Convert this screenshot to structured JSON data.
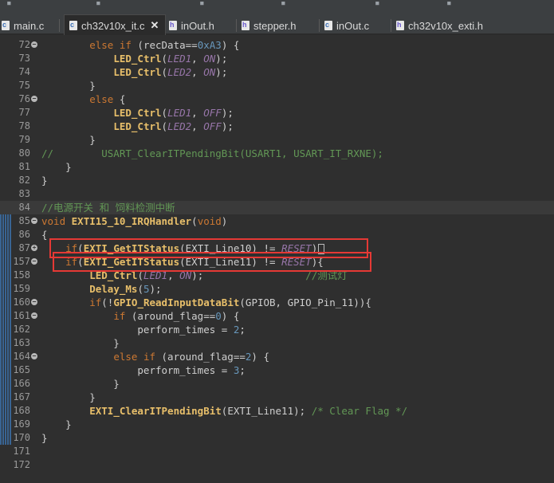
{
  "tabs": [
    {
      "label": "main.c",
      "type": "c",
      "active": false
    },
    {
      "label": "ch32v10x_it.c",
      "type": "c",
      "active": true
    },
    {
      "label": "inOut.h",
      "type": "h",
      "active": false
    },
    {
      "label": "stepper.h",
      "type": "h",
      "active": false
    },
    {
      "label": "inOut.c",
      "type": "c",
      "active": false
    },
    {
      "label": "ch32v10x_exti.h",
      "type": "h",
      "active": false
    }
  ],
  "close_glyph": "✕",
  "code_lines": [
    {
      "num": "72",
      "fold": "minus",
      "tokens": [
        [
          "pl",
          "        "
        ],
        [
          "kw",
          "else if"
        ],
        [
          "pl",
          " (recData=="
        ],
        [
          "num",
          "0xA3"
        ],
        [
          "pl",
          ") {"
        ]
      ]
    },
    {
      "num": "73",
      "tokens": [
        [
          "pl",
          "            "
        ],
        [
          "fn",
          "LED_Ctrl"
        ],
        [
          "pl",
          "("
        ],
        [
          "mac",
          "LED1"
        ],
        [
          "pl",
          ", "
        ],
        [
          "mac",
          "ON"
        ],
        [
          "pl",
          ");"
        ]
      ]
    },
    {
      "num": "74",
      "tokens": [
        [
          "pl",
          "            "
        ],
        [
          "fn",
          "LED_Ctrl"
        ],
        [
          "pl",
          "("
        ],
        [
          "mac",
          "LED2"
        ],
        [
          "pl",
          ", "
        ],
        [
          "mac",
          "ON"
        ],
        [
          "pl",
          ");"
        ]
      ]
    },
    {
      "num": "75",
      "tokens": [
        [
          "pl",
          "        }"
        ]
      ]
    },
    {
      "num": "76",
      "fold": "minus",
      "tokens": [
        [
          "pl",
          "        "
        ],
        [
          "kw",
          "else"
        ],
        [
          "pl",
          " {"
        ]
      ]
    },
    {
      "num": "77",
      "tokens": [
        [
          "pl",
          "            "
        ],
        [
          "fn",
          "LED_Ctrl"
        ],
        [
          "pl",
          "("
        ],
        [
          "mac",
          "LED1"
        ],
        [
          "pl",
          ", "
        ],
        [
          "mac",
          "OFF"
        ],
        [
          "pl",
          ");"
        ]
      ]
    },
    {
      "num": "78",
      "tokens": [
        [
          "pl",
          "            "
        ],
        [
          "fn",
          "LED_Ctrl"
        ],
        [
          "pl",
          "("
        ],
        [
          "mac",
          "LED2"
        ],
        [
          "pl",
          ", "
        ],
        [
          "mac",
          "OFF"
        ],
        [
          "pl",
          ");"
        ]
      ]
    },
    {
      "num": "79",
      "tokens": [
        [
          "pl",
          "        }"
        ]
      ]
    },
    {
      "num": "80",
      "tokens": [
        [
          "cm",
          "//        USART_ClearITPendingBit(USART1, USART_IT_RXNE);"
        ]
      ]
    },
    {
      "num": "81",
      "tokens": [
        [
          "pl",
          "    }"
        ]
      ]
    },
    {
      "num": "82",
      "tokens": [
        [
          "pl",
          "}"
        ]
      ]
    },
    {
      "num": "83",
      "tokens": []
    },
    {
      "num": "84",
      "highlight": true,
      "tokens": [
        [
          "cm",
          "//电源开关 和 饲料检测中断"
        ]
      ]
    },
    {
      "num": "85",
      "fold": "minus",
      "tokens": [
        [
          "kw",
          "void"
        ],
        [
          "pl",
          " "
        ],
        [
          "fn",
          "EXTI15_10_IRQHandler"
        ],
        [
          "pl",
          "("
        ],
        [
          "kw",
          "void"
        ],
        [
          "pl",
          ")"
        ]
      ]
    },
    {
      "num": "86",
      "tokens": [
        [
          "pl",
          "{"
        ]
      ]
    },
    {
      "num": "87",
      "fold": "plus",
      "tokens": [
        [
          "pl",
          "    "
        ],
        [
          "kw",
          "if"
        ],
        [
          "pl",
          "("
        ],
        [
          "fn",
          "EXTI_GetITStatus"
        ],
        [
          "pl",
          "(EXTI_Line10) != "
        ],
        [
          "mac",
          "RESET"
        ],
        [
          "pl",
          ")"
        ]
      ],
      "caret": true
    },
    {
      "num": "157",
      "fold": "minus",
      "tokens": [
        [
          "pl",
          "    "
        ],
        [
          "kw",
          "if"
        ],
        [
          "pl",
          "("
        ],
        [
          "fn",
          "EXTI_GetITStatus"
        ],
        [
          "pl",
          "(EXTI_Line11) != "
        ],
        [
          "mac",
          "RESET"
        ],
        [
          "pl",
          "){"
        ]
      ]
    },
    {
      "num": "158",
      "tokens": [
        [
          "pl",
          "        "
        ],
        [
          "fn",
          "LED_Ctrl"
        ],
        [
          "pl",
          "("
        ],
        [
          "mac",
          "LED1"
        ],
        [
          "pl",
          ", "
        ],
        [
          "mac",
          "ON"
        ],
        [
          "pl",
          ");                 "
        ],
        [
          "cm",
          "//测试灯"
        ]
      ]
    },
    {
      "num": "159",
      "tokens": [
        [
          "pl",
          "        "
        ],
        [
          "fn",
          "Delay_Ms"
        ],
        [
          "pl",
          "("
        ],
        [
          "num",
          "5"
        ],
        [
          "pl",
          ");"
        ]
      ]
    },
    {
      "num": "160",
      "fold": "minus",
      "tokens": [
        [
          "pl",
          "        "
        ],
        [
          "kw",
          "if"
        ],
        [
          "pl",
          "(!"
        ],
        [
          "fn",
          "GPIO_ReadInputDataBit"
        ],
        [
          "pl",
          "(GPIOB, GPIO_Pin_11)){"
        ]
      ]
    },
    {
      "num": "161",
      "fold": "minus",
      "tokens": [
        [
          "pl",
          "            "
        ],
        [
          "kw",
          "if"
        ],
        [
          "pl",
          " (around_flag=="
        ],
        [
          "num",
          "0"
        ],
        [
          "pl",
          ") {"
        ]
      ]
    },
    {
      "num": "162",
      "tokens": [
        [
          "pl",
          "                perform_times = "
        ],
        [
          "num",
          "2"
        ],
        [
          "pl",
          ";"
        ]
      ]
    },
    {
      "num": "163",
      "tokens": [
        [
          "pl",
          "            }"
        ]
      ]
    },
    {
      "num": "164",
      "fold": "minus",
      "tokens": [
        [
          "pl",
          "            "
        ],
        [
          "kw",
          "else if"
        ],
        [
          "pl",
          " (around_flag=="
        ],
        [
          "num",
          "2"
        ],
        [
          "pl",
          ") {"
        ]
      ]
    },
    {
      "num": "165",
      "tokens": [
        [
          "pl",
          "                perform_times = "
        ],
        [
          "num",
          "3"
        ],
        [
          "pl",
          ";"
        ]
      ]
    },
    {
      "num": "166",
      "tokens": [
        [
          "pl",
          "            }"
        ]
      ]
    },
    {
      "num": "167",
      "tokens": [
        [
          "pl",
          "        }"
        ]
      ]
    },
    {
      "num": "168",
      "tokens": [
        [
          "pl",
          "        "
        ],
        [
          "fn",
          "EXTI_ClearITPendingBit"
        ],
        [
          "pl",
          "(EXTI_Line11); "
        ],
        [
          "cm",
          "/* Clear Flag */"
        ]
      ]
    },
    {
      "num": "169",
      "tokens": [
        [
          "pl",
          "    }"
        ]
      ]
    },
    {
      "num": "170",
      "tokens": [
        [
          "pl",
          "}"
        ]
      ]
    },
    {
      "num": "171",
      "tokens": []
    },
    {
      "num": "172",
      "tokens": []
    }
  ],
  "colors": {
    "keyword": "#cc7832",
    "function": "#e8bf6a",
    "macro": "#9876aa",
    "comment": "#629755",
    "number": "#6897bb",
    "annotation_box": "#e53935"
  }
}
